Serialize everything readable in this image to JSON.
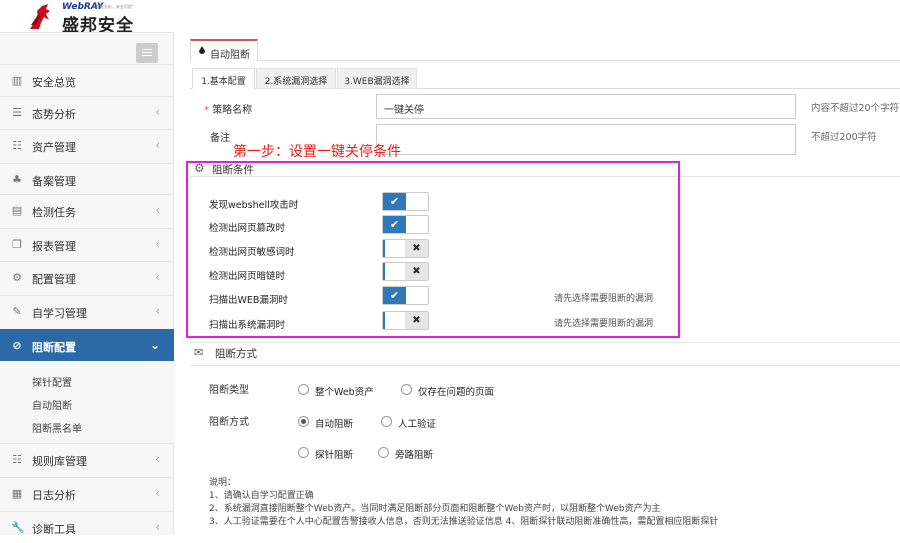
{
  "brand": {
    "sub": "WebRAY",
    "tagline": "\"数据无价，安全可信\"",
    "name": "盛邦安全"
  },
  "sidebar": {
    "items": [
      {
        "label": "安全总览",
        "icon": "bar-chart-icon"
      },
      {
        "label": "态势分析",
        "icon": "list-icon"
      },
      {
        "label": "资产管理",
        "icon": "list-icon"
      },
      {
        "label": "备案管理",
        "icon": "sitemap-icon"
      },
      {
        "label": "检测任务",
        "icon": "server-icon"
      },
      {
        "label": "报表管理",
        "icon": "copy-icon"
      },
      {
        "label": "配置管理",
        "icon": "gear-icon"
      },
      {
        "label": "自学习管理",
        "icon": "edit-icon"
      },
      {
        "label": "阻断配置",
        "icon": "ban-icon"
      },
      {
        "label": "规则库管理",
        "icon": "grid-icon"
      },
      {
        "label": "日志分析",
        "icon": "calendar-icon"
      },
      {
        "label": "诊断工具",
        "icon": "wrench-icon"
      }
    ],
    "submenu": [
      "探针配置",
      "自动阻断",
      "阻断黑名单"
    ]
  },
  "page": {
    "tab": "自动阻断",
    "subtabs": [
      "1.基本配置",
      "2.系统漏洞选择",
      "3.WEB漏洞选择"
    ]
  },
  "form": {
    "policy_label": "策略名称",
    "policy_value": "一键关停",
    "policy_hint": "内容不超过20个字符",
    "remark_label": "备注",
    "remark_hint": "不超过200字符"
  },
  "annotation": "第一步：设置一键关停条件",
  "conditions": {
    "title": "阻断条件",
    "rows": [
      {
        "label": "发现webshell攻击时",
        "on": true,
        "hint": ""
      },
      {
        "label": "检测出网页篡改时",
        "on": true,
        "hint": ""
      },
      {
        "label": "检测出网页敏感词时",
        "on": false,
        "hint": ""
      },
      {
        "label": "检测出网页暗链时",
        "on": false,
        "hint": ""
      },
      {
        "label": "扫描出WEB漏洞时",
        "on": true,
        "hint": "请先选择需要阻断的漏洞"
      },
      {
        "label": "扫描出系统漏洞时",
        "on": false,
        "hint": "请先选择需要阻断的漏洞"
      }
    ]
  },
  "method": {
    "title": "阻断方式",
    "type_label": "阻断类型",
    "type_options": [
      "整个Web资产",
      "仅存在问题的页面"
    ],
    "mode_label": "阻断方式",
    "mode_options": [
      "自动阻断",
      "人工验证",
      "探针阻断",
      "旁路阻断"
    ],
    "mode_selected": "自动阻断"
  },
  "notes": [
    "说明：",
    "1、请确认自学习配置正确",
    "2、系统漏洞直接阻断整个Web资产。当同时满足阻断部分页面和阻断整个Web资产时，以阻断整个Web资产为主",
    "3、人工验证需要在个人中心配置告警接收人信息，否则无法推送验证信息 4、阻断探针联动阻断准确性高，需配置相应阻断探针"
  ]
}
